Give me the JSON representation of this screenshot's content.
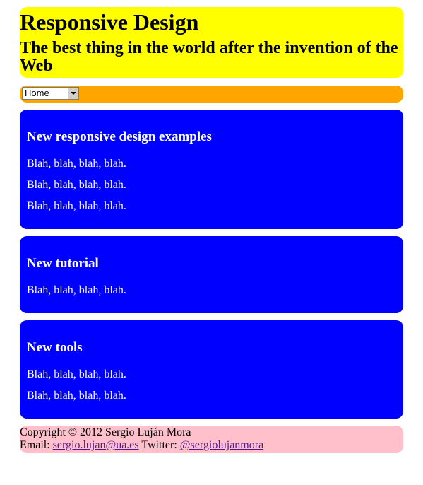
{
  "colors": {
    "header_bg": "#ffff00",
    "nav_bg": "#ffa500",
    "article_bg": "#0000ff",
    "footer_bg": "#ffc0cb"
  },
  "header": {
    "title": "Responsive Design",
    "subtitle": "The best thing in the world after the invention of the Web"
  },
  "nav": {
    "selected": "Home"
  },
  "articles": [
    {
      "title": "New responsive design examples",
      "paragraphs": [
        "Blah, blah, blah, blah.",
        "Blah, blah, blah, blah.",
        "Blah, blah, blah, blah."
      ]
    },
    {
      "title": "New tutorial",
      "paragraphs": [
        "Blah, blah, blah, blah."
      ]
    },
    {
      "title": "New tools",
      "paragraphs": [
        "Blah, blah, blah, blah.",
        "Blah, blah, blah, blah."
      ]
    }
  ],
  "footer": {
    "copyright": "Copyright © 2012 Sergio Luján Mora",
    "email_label": "Email: ",
    "email_link": "sergio.lujan@ua.es",
    "twitter_label": " Twitter: ",
    "twitter_link": "@sergiolujanmora"
  }
}
